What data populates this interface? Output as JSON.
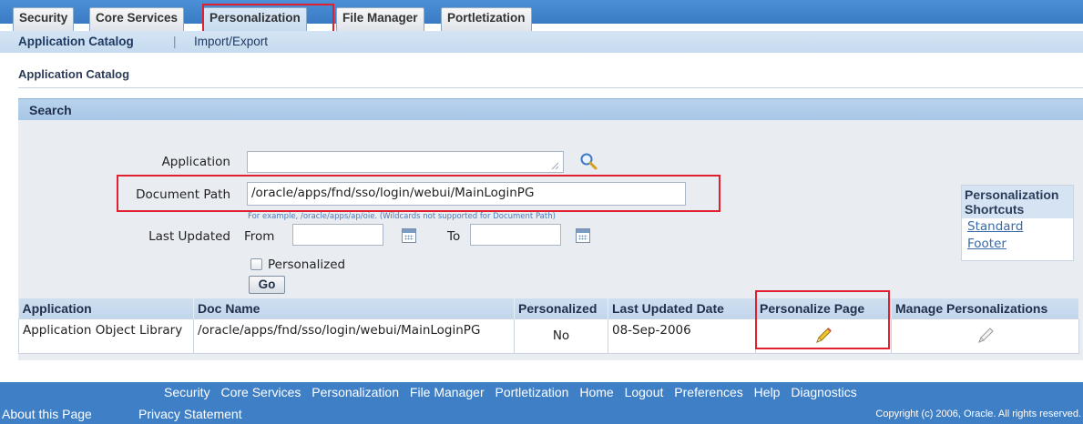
{
  "tabs": [
    {
      "label": "Security"
    },
    {
      "label": "Core Services"
    },
    {
      "label": "Personalization",
      "active": true
    },
    {
      "label": "File Manager"
    },
    {
      "label": "Portletization"
    }
  ],
  "subtabs": {
    "active": "Application Catalog",
    "separator": "|",
    "other": "Import/Export"
  },
  "breadcrumb": "Application Catalog",
  "search": {
    "header": "Search",
    "application_label": "Application",
    "application_value": "",
    "doc_path_label": "Document Path",
    "doc_path_value": "/oracle/apps/fnd/sso/login/webui/MainLoginPG",
    "doc_path_hint": "For example, /oracle/apps/ap/oie. (Wildcards not supported for Document Path)",
    "last_updated_label": "Last Updated",
    "from_label": "From",
    "to_label": "To",
    "personalized_label": "Personalized",
    "go_label": "Go",
    "icons": {
      "search": "magnifier-icon",
      "calendar": "calendar-icon"
    }
  },
  "shortcuts": {
    "title_line1": "Personalization",
    "title_line2": "Shortcuts",
    "links": [
      "Standard",
      "Footer"
    ]
  },
  "results": {
    "columns": [
      "Application",
      "Doc Name",
      "Personalized",
      "Last Updated Date",
      "Personalize Page",
      "Manage Personalizations"
    ],
    "rows": [
      {
        "application": "Application Object Library",
        "doc_name": "/oracle/apps/fnd/sso/login/webui/MainLoginPG",
        "personalized": "No",
        "last_updated": "08-Sep-2006",
        "personalize_icon": "pencil-icon",
        "manage_icon": "pencil-disabled-icon"
      }
    ]
  },
  "footer": {
    "links": [
      "Security",
      "Core Services",
      "Personalization",
      "File Manager",
      "Portletization",
      "Home",
      "Logout",
      "Preferences",
      "Help",
      "Diagnostics"
    ],
    "about": "About this Page",
    "privacy": "Privacy Statement",
    "copyright": "Copyright (c) 2006, Oracle. All rights reserved."
  },
  "colors": {
    "highlight": "#e0202f",
    "header_blue": "#3f7fc6"
  }
}
